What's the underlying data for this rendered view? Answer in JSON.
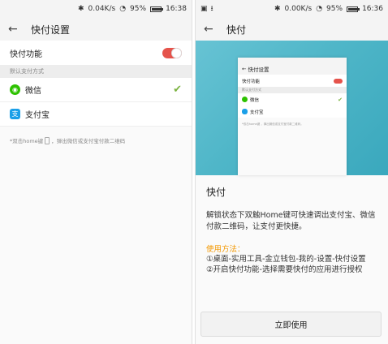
{
  "left": {
    "status": {
      "speed": "0.04K/s",
      "battery": "95%",
      "time": "16:38",
      "battery_level": 0.95
    },
    "title": "快付设置",
    "toggle_label": "快付功能",
    "toggle_on": true,
    "section": "默认支付方式",
    "apps": [
      {
        "name": "微信",
        "icon": "wechat-icon",
        "selected": true
      },
      {
        "name": "支付宝",
        "icon": "alipay-icon",
        "selected": false
      }
    ],
    "hint_before": "*双击home键",
    "hint_after": "，弹出微信或支付宝付款二维码"
  },
  "right": {
    "status": {
      "speed": "0.00K/s",
      "battery": "95%",
      "time": "16:36",
      "battery_level": 0.95
    },
    "title": "快付",
    "preview": {
      "time": "16:46",
      "title": "快付设置",
      "toggle_label": "快付功能",
      "section": "默认支付方式",
      "app1": "微信",
      "app2": "支付宝",
      "hint": "*双击home键   ，弹出微信或支付宝付款二维码。"
    },
    "heading": "快付",
    "description": "解锁状态下双触Home键可快速调出支付宝、微信付款二维码，让支付更快捷。",
    "method_label": "使用方法：",
    "steps": [
      "①桌面-实用工具-金立钱包-我的-设置-快付设置",
      "②开启快付功能-选择需要快付的应用进行授权"
    ],
    "button": "立即使用"
  },
  "colors": {
    "toggle_on": "#e5534b",
    "wechat": "#2dc100",
    "alipay": "#1a9fe8",
    "check": "#7cb342",
    "method": "#f39800",
    "hero": "#4fb6c8"
  }
}
